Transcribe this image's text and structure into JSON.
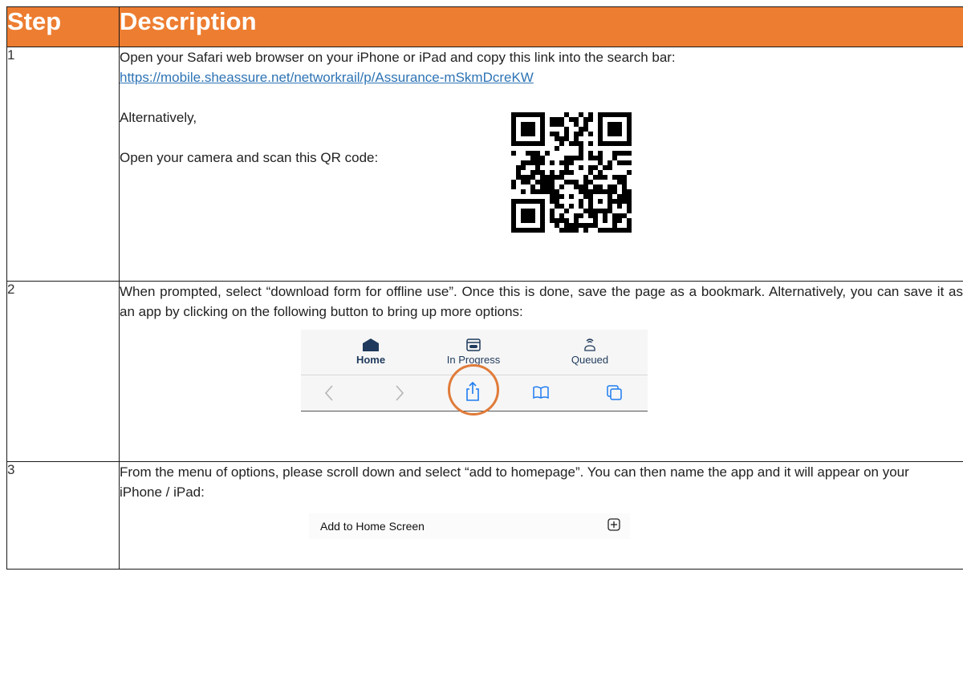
{
  "table": {
    "header": {
      "step": "Step",
      "description": "Description"
    },
    "rows": [
      {
        "step": "1",
        "line1": "Open your Safari web browser on your iPhone or iPad and copy this link into the search bar:",
        "link": "https://mobile.sheassure.net/networkrail/p/Assurance-mSkmDcreKW",
        "alternatively": "Alternatively,",
        "scan": "Open your camera and scan this QR code:"
      },
      {
        "step": "2",
        "text": "When prompted, select “download form for offline use”. Once this is done, save the page as a bookmark. Alternatively, you can save it as an app by clicking on the following button to bring up more options:"
      },
      {
        "step": "3",
        "text": "From the menu of options, please scroll down and select “add to homepage”. You can then name the app and it will appear on your iPhone / iPad:"
      }
    ]
  },
  "toolbar": {
    "tabs": [
      {
        "label": "Home",
        "icon": "home-icon"
      },
      {
        "label": "In Progress",
        "icon": "in-progress-icon"
      },
      {
        "label": "Queued",
        "icon": "queued-icon"
      }
    ],
    "nav_icons": [
      "back-chevron-icon",
      "forward-chevron-icon",
      "share-icon",
      "bookmarks-icon",
      "tabs-icon"
    ],
    "highlight_color": "#e07b39"
  },
  "add_home": {
    "label": "Add to Home Screen",
    "icon": "plus-square-icon"
  },
  "colors": {
    "header_bg": "#ed7d31",
    "link": "#2e74b5"
  }
}
